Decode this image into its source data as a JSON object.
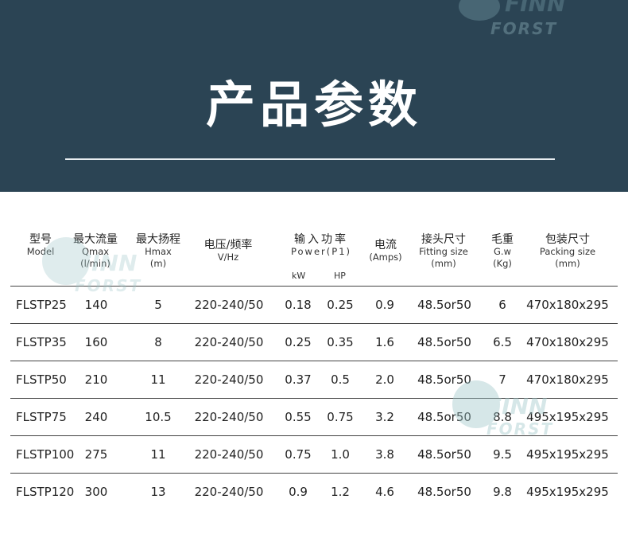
{
  "banner": {
    "title": "产品参数",
    "watermark_top": "FORST"
  },
  "watermark": {
    "word1": "FINN",
    "word2": "FORST"
  },
  "colors": {
    "banner_bg": "#2b4454",
    "watermark": "#9fc7c9"
  },
  "table": {
    "headers": [
      {
        "cn": "型号",
        "en": "Model",
        "en2": ""
      },
      {
        "cn": "最大流量",
        "en": "Qmax",
        "en2": "(l/min)"
      },
      {
        "cn": "最大扬程",
        "en": "Hmax",
        "en2": "(m)"
      },
      {
        "cn": "电压/频率",
        "en": "V/Hz",
        "en2": ""
      },
      {
        "cn": "输入功率",
        "en": "Power(P1)",
        "en2": ""
      },
      {
        "cn": "电流",
        "en": "(Amps)",
        "en2": ""
      },
      {
        "cn": "接头尺寸",
        "en": "Fitting size",
        "en2": "(mm)"
      },
      {
        "cn": "毛重",
        "en": "G.w",
        "en2": "(Kg)"
      },
      {
        "cn": "包装尺寸",
        "en": "Packing size",
        "en2": "(mm)"
      }
    ],
    "power_sub": {
      "kw": "kW",
      "hp": "HP"
    },
    "rows": [
      {
        "model": "FLSTP25",
        "qmax": "140",
        "hmax": "5",
        "vhz": "220-240/50",
        "kw": "0.18",
        "hp": "0.25",
        "amps": "0.9",
        "fitting": "48.5or50",
        "gw": "6",
        "packing": "470x180x295"
      },
      {
        "model": "FLSTP35",
        "qmax": "160",
        "hmax": "8",
        "vhz": "220-240/50",
        "kw": "0.25",
        "hp": "0.35",
        "amps": "1.6",
        "fitting": "48.5or50",
        "gw": "6.5",
        "packing": "470x180x295"
      },
      {
        "model": "FLSTP50",
        "qmax": "210",
        "hmax": "11",
        "vhz": "220-240/50",
        "kw": "0.37",
        "hp": "0.5",
        "amps": "2.0",
        "fitting": "48.5or50",
        "gw": "7",
        "packing": "470x180x295"
      },
      {
        "model": "FLSTP75",
        "qmax": "240",
        "hmax": "10.5",
        "vhz": "220-240/50",
        "kw": "0.55",
        "hp": "0.75",
        "amps": "3.2",
        "fitting": "48.5or50",
        "gw": "8.8",
        "packing": "495x195x295"
      },
      {
        "model": "FLSTP100",
        "qmax": "275",
        "hmax": "11",
        "vhz": "220-240/50",
        "kw": "0.75",
        "hp": "1.0",
        "amps": "3.8",
        "fitting": "48.5or50",
        "gw": "9.5",
        "packing": "495x195x295"
      },
      {
        "model": "FLSTP120",
        "qmax": "300",
        "hmax": "13",
        "vhz": "220-240/50",
        "kw": "0.9",
        "hp": "1.2",
        "amps": "4.6",
        "fitting": "48.5or50",
        "gw": "9.8",
        "packing": "495x195x295"
      }
    ]
  }
}
